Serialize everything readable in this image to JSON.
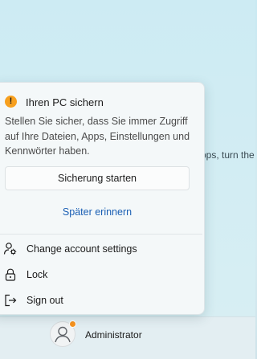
{
  "background": {
    "text_fragment": "pps, turn the"
  },
  "flyout": {
    "alert": {
      "icon": "warning-icon",
      "icon_glyph": "!",
      "title": "Ihren PC sichern",
      "body": "Stellen Sie sicher, dass Sie immer Zugriff auf Ihre Dateien, Apps, Einstellungen und Kennwörter haben.",
      "primary_button": "Sicherung starten",
      "secondary_link": "Später erinnern"
    },
    "menu": [
      {
        "label": "Change account settings",
        "icon": "person-gear-icon"
      },
      {
        "label": "Lock",
        "icon": "lock-icon"
      },
      {
        "label": "Sign out",
        "icon": "sign-out-icon"
      }
    ]
  },
  "taskbar": {
    "user_name": "Administrator",
    "avatar_icon": "user-avatar-icon",
    "badge_color": "#f7931e"
  },
  "colors": {
    "accent_link": "#1a5fb4",
    "warning": "#f7a01f"
  }
}
